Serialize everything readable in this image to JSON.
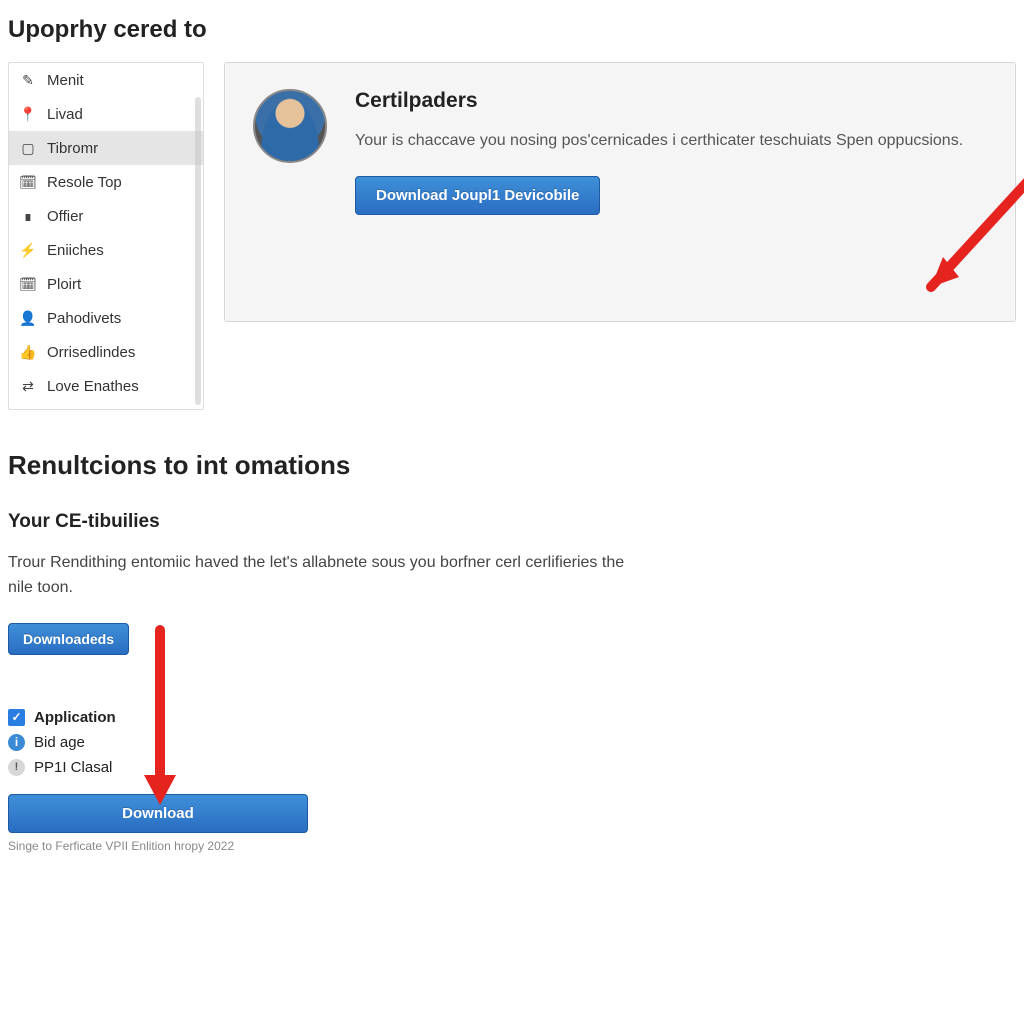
{
  "page_title": "Upoprhy cered to",
  "sidebar": {
    "items": [
      {
        "label": "Menit",
        "icon": "✎"
      },
      {
        "label": "Livad",
        "icon": "📍"
      },
      {
        "label": "Tibromr",
        "icon": "▢",
        "active": true
      },
      {
        "label": "Resole Top",
        "icon": "🗓"
      },
      {
        "label": "Offier",
        "icon": "∎"
      },
      {
        "label": "Eniiches",
        "icon": "⚡"
      },
      {
        "label": "Ploirt",
        "icon": "🗓"
      },
      {
        "label": "Pahodivets",
        "icon": "👤"
      },
      {
        "label": "Orrisedlindes",
        "icon": "👍"
      },
      {
        "label": "Love Enathes",
        "icon": "⇄"
      }
    ]
  },
  "card": {
    "title": "Certilpaders",
    "text": "Your is chaccave you nosing pos'cernicades i certhicater teschuiats Spen oppucsions.",
    "button_label": "Download Joupl1 Devicobile"
  },
  "section2": {
    "title": "Renultcions to int omations",
    "subtitle": "Your CE-tibuilies",
    "text": "Trour Rendithing entomiic haved the let's allabnete sous you borfner cerl cerlifieries the nile toon.",
    "button1_label": "Downloadeds",
    "options": [
      {
        "kind": "check",
        "label": "Application",
        "bold": true
      },
      {
        "kind": "info",
        "label": "Bid age"
      },
      {
        "kind": "warn",
        "label": "PP1I Clasal"
      }
    ],
    "button2_label": "Download",
    "footnote": "Singe to Ferficate VPII Enlition hropy 2022"
  }
}
